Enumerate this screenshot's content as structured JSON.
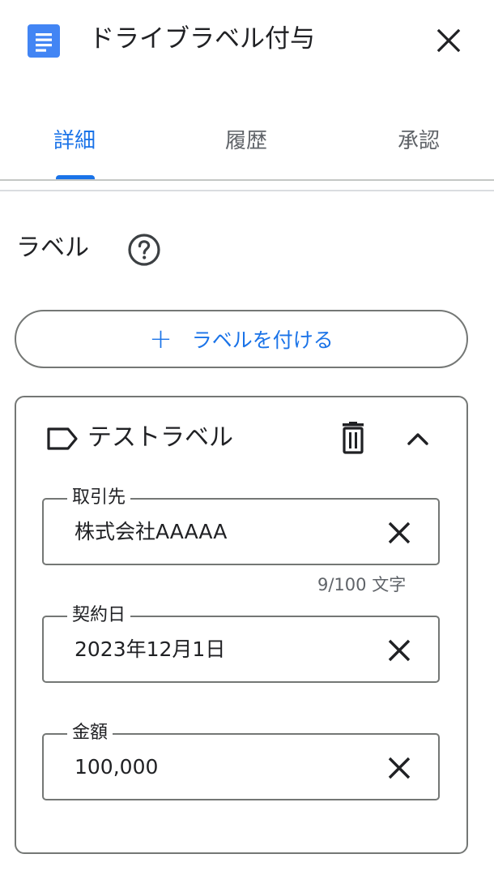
{
  "header": {
    "app_icon": "google-docs-icon",
    "title": "ドライブラベル付与",
    "close_icon": "close-icon"
  },
  "tabs": [
    {
      "label": "詳細",
      "active": true
    },
    {
      "label": "履歴",
      "active": false
    },
    {
      "label": "承認",
      "active": false
    }
  ],
  "section": {
    "title": "ラベル",
    "help_icon": "help-circle-icon",
    "add_button_label": "ラベルを付ける",
    "add_button_icon": "plus-icon"
  },
  "label_card": {
    "icon": "label-tag-icon",
    "name": "テストラベル",
    "delete_icon": "trash-icon",
    "collapse_icon": "chevron-up-icon",
    "fields": [
      {
        "label": "取引先",
        "value": "株式会社AAAAA",
        "counter": "9/100 文字"
      },
      {
        "label": "契約日",
        "value": "2023年12月1日"
      },
      {
        "label": "金額",
        "value": "100,000"
      }
    ]
  },
  "colors": {
    "accent": "#1a73e8",
    "docs_icon": "#4285f4",
    "text": "#202124",
    "secondary_text": "#5f6368",
    "outline": "#747775"
  }
}
